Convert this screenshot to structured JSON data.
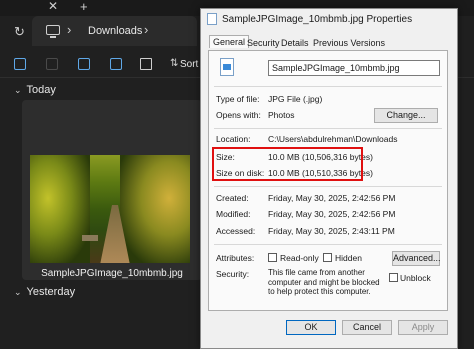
{
  "explorer": {
    "location": "Downloads",
    "toolbar": {
      "sort_label": "Sort"
    },
    "groups": {
      "today": "Today",
      "yesterday": "Yesterday"
    },
    "file": {
      "name": "SampleJPGImage_10mbmb.jpg"
    }
  },
  "dialog": {
    "title": "SampleJPGImage_10mbmb.jpg Properties",
    "tabs": [
      "General",
      "Security",
      "Details",
      "Previous Versions"
    ],
    "filename": "SampleJPGImage_10mbmb.jpg",
    "type_label": "Type of file:",
    "type_value": "JPG File (.jpg)",
    "opens_label": "Opens with:",
    "opens_value": "Photos",
    "change_button": "Change...",
    "location_label": "Location:",
    "location_value": "C:\\Users\\abdulrehman\\Downloads",
    "size_label": "Size:",
    "size_value": "10.0 MB (10,506,316 bytes)",
    "disk_label": "Size on disk:",
    "disk_value": "10.0 MB (10,510,336 bytes)",
    "created_label": "Created:",
    "created_value": "Friday, May 30, 2025, 2:42:56 PM",
    "modified_label": "Modified:",
    "modified_value": "Friday, May 30, 2025, 2:42:56 PM",
    "accessed_label": "Accessed:",
    "accessed_value": "Friday, May 30, 2025, 2:43:11 PM",
    "attributes_label": "Attributes:",
    "readonly_label": "Read-only",
    "hidden_label": "Hidden",
    "advanced_button": "Advanced...",
    "security_label": "Security:",
    "security_text": "This file came from another computer and might be blocked to help protect this computer.",
    "unblock_label": "Unblock",
    "ok_button": "OK",
    "cancel_button": "Cancel",
    "apply_button": "Apply"
  }
}
